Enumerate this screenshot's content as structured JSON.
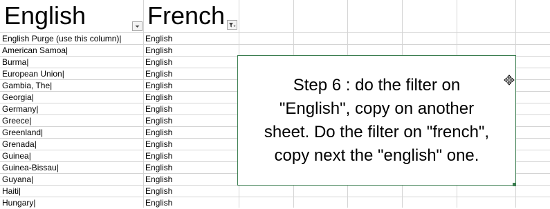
{
  "headers": {
    "col_a": "English",
    "col_b": "French"
  },
  "filter_icons": {
    "col_a": "dropdown-arrow-icon",
    "col_b": "filter-active-icon"
  },
  "rows": [
    {
      "a": "English Purge (use this column)|",
      "b": "English"
    },
    {
      "a": "American Samoa|",
      "b": "English"
    },
    {
      "a": "Burma|",
      "b": "English"
    },
    {
      "a": "European Union|",
      "b": "English"
    },
    {
      "a": "Gambia, The|",
      "b": "English"
    },
    {
      "a": "Georgia|",
      "b": "English"
    },
    {
      "a": "Germany|",
      "b": "English"
    },
    {
      "a": "Greece|",
      "b": "English"
    },
    {
      "a": "Greenland|",
      "b": "English"
    },
    {
      "a": "Grenada|",
      "b": "English"
    },
    {
      "a": "Guinea|",
      "b": "English"
    },
    {
      "a": "Guinea-Bissau|",
      "b": "English"
    },
    {
      "a": "Guyana|",
      "b": "English"
    },
    {
      "a": "Haiti|",
      "b": "English"
    },
    {
      "a": "Hungary|",
      "b": "English"
    }
  ],
  "textbox": {
    "text": "Step 6 : do the filter on\n\"English\", copy on another\nsheet. Do the filter on \"french\",\ncopy next the \"english\" one."
  },
  "colors": {
    "gridline": "#d4d4d4",
    "textbox_border": "#3a7d4f"
  }
}
